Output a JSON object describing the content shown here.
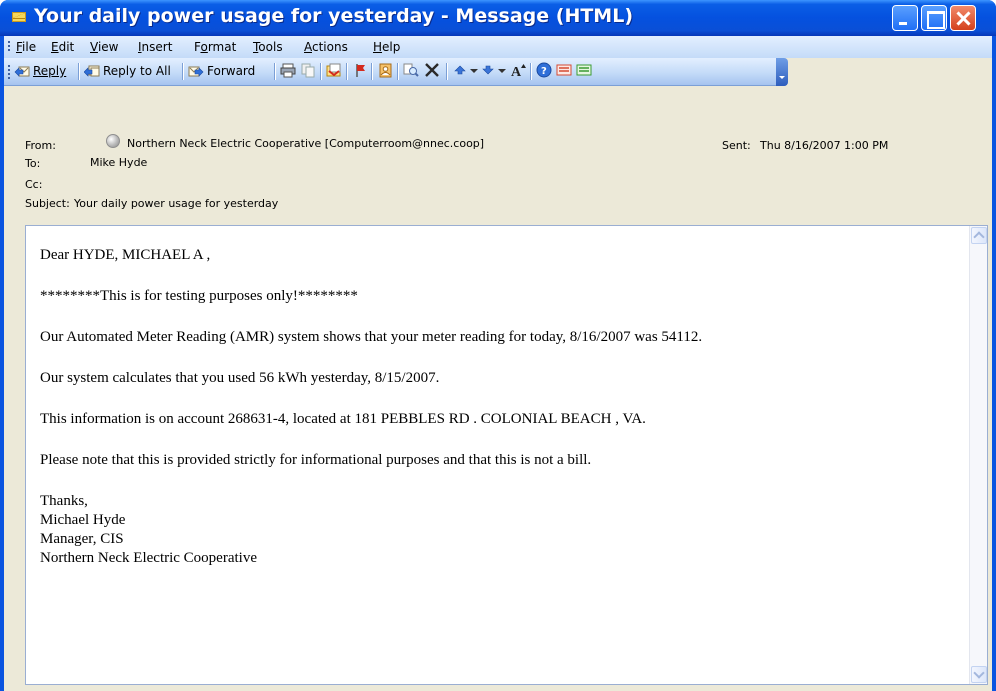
{
  "window": {
    "title": "Your daily power usage for yesterday - Message (HTML)"
  },
  "menu": [
    {
      "label": "File",
      "underline": "F"
    },
    {
      "label": "Edit",
      "underline": "E"
    },
    {
      "label": "View",
      "underline": "V"
    },
    {
      "label": "Insert",
      "underline": "I"
    },
    {
      "label": "Format",
      "underline": "o"
    },
    {
      "label": "Tools",
      "underline": "T"
    },
    {
      "label": "Actions",
      "underline": "A"
    },
    {
      "label": "Help",
      "underline": "H"
    }
  ],
  "toolbar": {
    "reply_label": "Reply",
    "reply_all_label": "Reply to All",
    "forward_label": "Forward",
    "icons": [
      "print-icon",
      "copy-icon",
      "move-to-folder-icon",
      "flag-icon",
      "address-book-icon",
      "find-icon",
      "delete-icon",
      "previous-item-icon",
      "next-item-icon",
      "font-size-icon",
      "help-icon",
      "junk-mail-icon",
      "not-junk-icon"
    ]
  },
  "header": {
    "from_label": "From:",
    "from_value": "Northern Neck Electric Cooperative [Computerroom@nnec.coop]",
    "to_label": "To:",
    "to_value": "Mike Hyde",
    "cc_label": "Cc:",
    "cc_value": "",
    "subject_label": "Subject:",
    "subject_value": "Your daily power usage for yesterday",
    "sent_label": "Sent:",
    "sent_value": "Thu 8/16/2007 1:00 PM"
  },
  "message": {
    "greeting": "Dear HYDE, MICHAEL A ,",
    "test_notice": "********This is for testing purposes only!********",
    "meter_reading": "Our Automated Meter Reading (AMR) system shows that your meter reading for today, 8/16/2007 was 54112.",
    "usage": "Our system calculates that you used 56 kWh yesterday, 8/15/2007.",
    "account": "This information is on account 268631-4, located at 181 PEBBLES RD . COLONIAL BEACH , VA.",
    "disclaimer": "Please note that this is provided strictly for informational purposes and that this is not a bill.",
    "signature": [
      "Thanks,",
      "Michael Hyde",
      "Manager, CIS",
      "Northern Neck Electric Cooperative"
    ]
  },
  "colors": {
    "titlebar": "#0551df",
    "menubar": "#c4dbf8",
    "header_bg": "#ece9d8",
    "close_button": "#d4401c"
  }
}
